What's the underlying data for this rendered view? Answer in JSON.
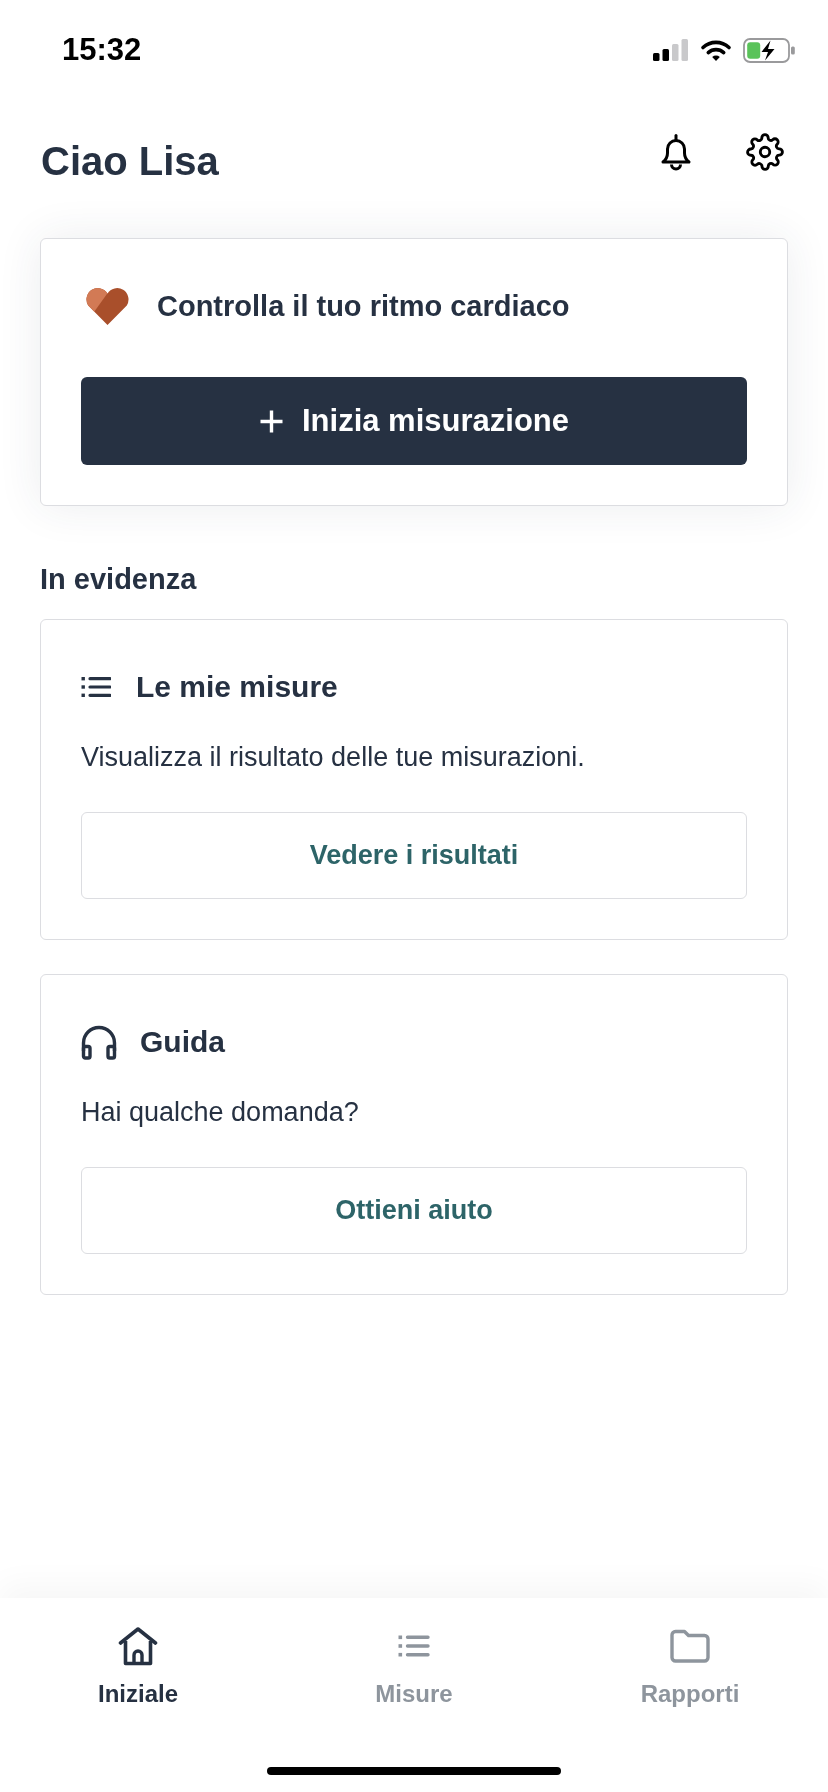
{
  "status_bar": {
    "time": "15:32"
  },
  "header": {
    "greeting": "Ciao Lisa"
  },
  "heart_card": {
    "title": "Controlla il tuo ritmo cardiaco",
    "button": "Inizia misurazione"
  },
  "featured": {
    "heading": "In evidenza",
    "cards": [
      {
        "kind": "list",
        "title": "Le mie misure",
        "description": "Visualizza il risultato delle tue misurazioni.",
        "button": "Vedere i risultati"
      },
      {
        "kind": "headphones",
        "title": "Guida",
        "description": "Hai qualche domanda?",
        "button": "Ottieni aiuto"
      }
    ]
  },
  "tab_bar": {
    "tabs": [
      {
        "kind": "home",
        "label": "Iniziale",
        "selected": true
      },
      {
        "kind": "list",
        "label": "Misure",
        "selected": false
      },
      {
        "kind": "folder",
        "label": "Rapporti",
        "selected": false
      }
    ]
  }
}
